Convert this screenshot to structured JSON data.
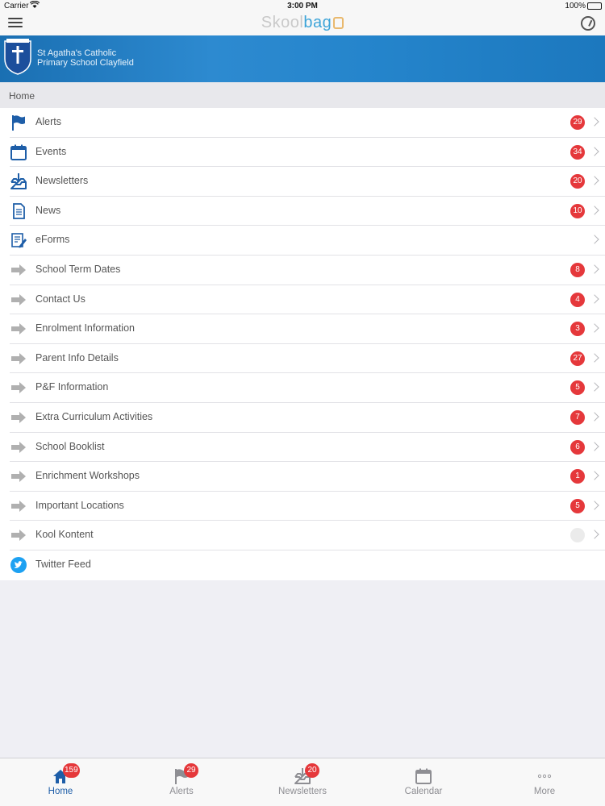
{
  "status_bar": {
    "carrier": "Carrier",
    "time": "3:00 PM",
    "battery": "100%"
  },
  "app": {
    "logo_part1": "Skool",
    "logo_part2": "bag"
  },
  "banner": {
    "school_name_line1": "St Agatha's Catholic",
    "school_name_line2": "Primary School Clayfield"
  },
  "breadcrumb": "Home",
  "menu_items": [
    {
      "label": "Alerts",
      "badge": "29",
      "icon": "flag-icon"
    },
    {
      "label": "Events",
      "badge": "34",
      "icon": "calendar-icon"
    },
    {
      "label": "Newsletters",
      "badge": "20",
      "icon": "inbox-download-icon"
    },
    {
      "label": "News",
      "badge": "10",
      "icon": "document-icon"
    },
    {
      "label": "eForms",
      "badge": "",
      "icon": "form-edit-icon"
    },
    {
      "label": "School Term Dates",
      "badge": "8",
      "icon": "arrow-right-icon"
    },
    {
      "label": "Contact Us",
      "badge": "4",
      "icon": "arrow-right-icon"
    },
    {
      "label": "Enrolment Information",
      "badge": "3",
      "icon": "arrow-right-icon"
    },
    {
      "label": "Parent Info Details",
      "badge": "27",
      "icon": "arrow-right-icon"
    },
    {
      "label": "P&F Information",
      "badge": "5",
      "icon": "arrow-right-icon"
    },
    {
      "label": "Extra Curriculum Activities",
      "badge": "7",
      "icon": "arrow-right-icon"
    },
    {
      "label": "School Booklist",
      "badge": "6",
      "icon": "arrow-right-icon"
    },
    {
      "label": "Enrichment Workshops",
      "badge": "1",
      "icon": "arrow-right-icon"
    },
    {
      "label": "Important Locations",
      "badge": "5",
      "icon": "arrow-right-icon"
    },
    {
      "label": "Kool Kontent",
      "badge": "",
      "icon": "arrow-right-icon"
    },
    {
      "label": "Twitter Feed",
      "badge": "",
      "icon": "twitter-icon"
    }
  ],
  "tabs": [
    {
      "label": "Home",
      "badge": "159",
      "icon": "home-icon",
      "active": true
    },
    {
      "label": "Alerts",
      "badge": "29",
      "icon": "flag-icon",
      "active": false
    },
    {
      "label": "Newsletters",
      "badge": "20",
      "icon": "inbox-download-icon",
      "active": false
    },
    {
      "label": "Calendar",
      "badge": "",
      "icon": "calendar-icon",
      "active": false
    },
    {
      "label": "More",
      "badge": "",
      "icon": "more-icon",
      "active": false
    }
  ],
  "colors": {
    "accent": "#1e5ea8",
    "banner": "#2585cc",
    "badge": "#e5383b",
    "twitter": "#1da1f2",
    "arrow_gray": "#b0b0b0"
  }
}
